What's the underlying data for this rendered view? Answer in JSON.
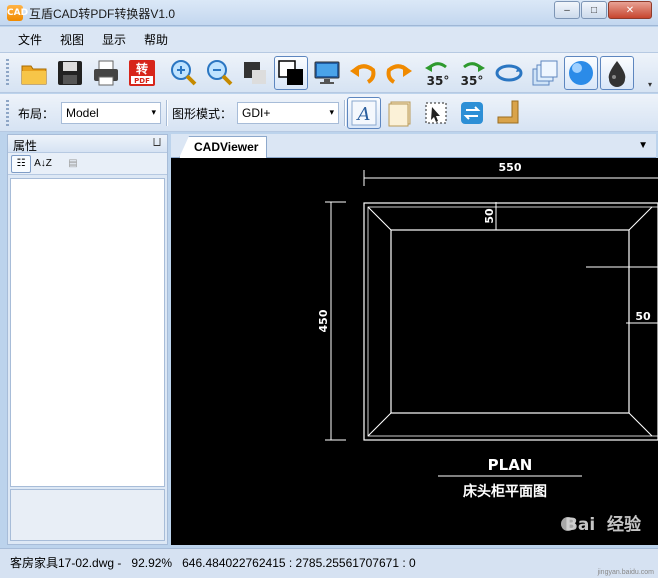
{
  "window": {
    "app_icon_text": "CAD",
    "title": "互盾CAD转PDF转换器V1.0",
    "minimize_glyph": "–",
    "maximize_glyph": "□",
    "close_glyph": "✕"
  },
  "menu": {
    "items": [
      "文件",
      "视图",
      "显示",
      "帮助"
    ]
  },
  "toolbar1": {
    "icons": [
      "open-folder-icon",
      "save-icon",
      "print-icon",
      "convert-to-pdf-icon",
      "zoom-in-icon",
      "zoom-out-icon",
      "black-background-icon",
      "white-background-icon",
      "monitor-icon",
      "undo-icon",
      "redo-icon",
      "rotate-left-35-icon",
      "rotate-right-35-icon",
      "rotate-icon",
      "layers-icon",
      "blue-sphere-icon",
      "ink-drop-icon"
    ],
    "convert_label_top": "转",
    "convert_label_bottom": "PDF",
    "rotate_left_label": "35°",
    "rotate_right_label": "35°",
    "overflow_glyph": "▾"
  },
  "toolbar2": {
    "layout_label": "布局：",
    "layout_value": "Model",
    "graphics_mode_label": "图形模式：",
    "graphics_mode_value": "GDI+",
    "caret": "▾",
    "text_icon_letter": "A",
    "icons": [
      "text-style-icon",
      "page-icon",
      "select-region-icon",
      "swap-icon",
      "corner-icon"
    ]
  },
  "properties_panel": {
    "title": "属性",
    "pin_glyph": "⨆",
    "categorized_label": "☷",
    "sort_label": "A↓Z",
    "pages_label": "▤"
  },
  "document": {
    "tab_label": "CADViewer",
    "tab_menu_glyph": "▼"
  },
  "drawing": {
    "width_dim": "550",
    "height_dim": "450",
    "top_inset_dim": "50",
    "right_inset_dim": "50",
    "plan_label": "PLAN",
    "plan_subtitle": "床头柜平面图"
  },
  "status": {
    "file": "客房家具17-02.dwg",
    "zoom": "92.92%",
    "coords": "646.484022762415 : 2785.25561707671 : 0"
  },
  "watermark": {
    "brand": "Bai  经验",
    "url": "jingyan.baidu.com"
  },
  "colors": {
    "titlebar": "#c9dcf1",
    "viewer_bg": "#000000",
    "drawing_lines": "#ffffff"
  }
}
